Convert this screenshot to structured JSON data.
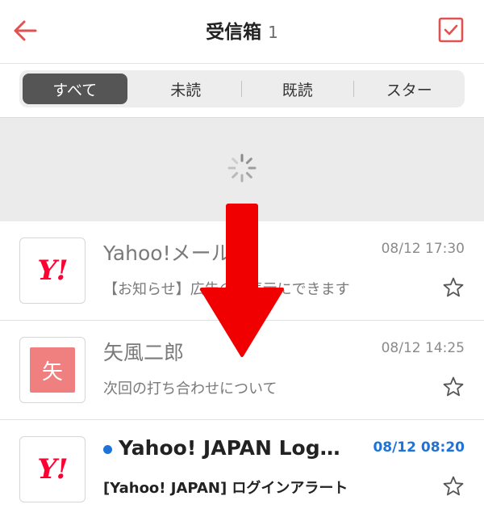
{
  "header": {
    "title": "受信箱",
    "count": "1",
    "accent_color": "#e05252"
  },
  "segments": [
    {
      "label": "すべて",
      "active": true
    },
    {
      "label": "未読",
      "active": false
    },
    {
      "label": "既読",
      "active": false
    },
    {
      "label": "スター",
      "active": false
    }
  ],
  "mails": [
    {
      "sender": "Yahoo!メール",
      "date": "08/12 17:30",
      "subject": "【お知らせ】広告の非表示にできます",
      "avatar": "Y!",
      "unread": false
    },
    {
      "sender": "矢風二郎",
      "date": "08/12 14:25",
      "subject": "次回の打ち合わせについて",
      "avatar": "矢",
      "unread": false
    },
    {
      "sender": "Yahoo! JAPAN Log…",
      "date": "08/12 08:20",
      "subject": "[Yahoo! JAPAN] ログインアラート",
      "avatar": "Y!",
      "unread": true
    }
  ],
  "icons": {
    "back": "arrow-left-icon",
    "select": "checkbox-checked-icon",
    "spinner": "loading-spinner-icon",
    "star": "star-outline-icon",
    "pull_arrow": "arrow-down-icon"
  },
  "colors": {
    "unread_blue": "#1f73d6",
    "pull_arrow_red": "#f00000",
    "yahoo_red": "#ff0033",
    "avatar_pink": "#f08080"
  }
}
